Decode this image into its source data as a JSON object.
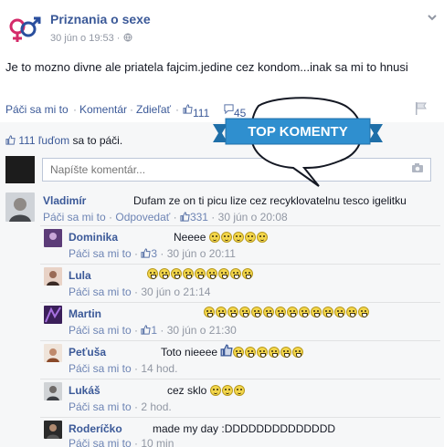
{
  "post": {
    "page_name": "Priznania o sexe",
    "date": "30 jún o 19:53",
    "separator": "·",
    "text": "Je to mozno divne ale priatela fajcim.jedine cez kondom...inak sa mi to hnusi",
    "actions": {
      "like": "Páči sa mi to",
      "comment": "Komentár",
      "share": "Zdieľať",
      "dot": "·",
      "like_count": "111",
      "comment_count": "45"
    },
    "likes_summary": {
      "count": "111 ľuďom",
      "suffix": "sa to páči."
    },
    "comment_placeholder": "Napíšte komentár..."
  },
  "banner": {
    "label": "TOP KOMENTY",
    "color": "#2f8fcf"
  },
  "comments": [
    {
      "name": "Vladimír",
      "text": "Dufam ze on ti picu lize cez recyklovatelnu tesco igelitku",
      "like": "Páči sa mi to",
      "reply": "Odpovedať",
      "likes": "331",
      "time": "30 jún o 20:08"
    },
    {
      "name": "Dominika",
      "text": "Neeee",
      "emoji_count": 5,
      "like": "Páči sa mi to",
      "likes": "3",
      "time": "30 jún o 20:11"
    },
    {
      "name": "Lula",
      "emoji_count": 9,
      "like": "Páči sa mi to",
      "time": "30 jún o 21:14"
    },
    {
      "name": "Martin",
      "emoji_count": 14,
      "like": "Páči sa mi to",
      "likes": "1",
      "time": "30 jún o 21:30"
    },
    {
      "name": "Peťuša",
      "text": "Toto nieeee",
      "emoji_count": 6,
      "like": "Páči sa mi to",
      "time": "14 hod."
    },
    {
      "name": "Lukáš",
      "text": "cez sklo",
      "emoji_count": 3,
      "like": "Páči sa mi to",
      "time": "2 hod."
    },
    {
      "name": "Roderíčko",
      "text": "made my day :DDDDDDDDDDDDDD",
      "like": "Páči sa mi to",
      "time": "10 min"
    }
  ]
}
